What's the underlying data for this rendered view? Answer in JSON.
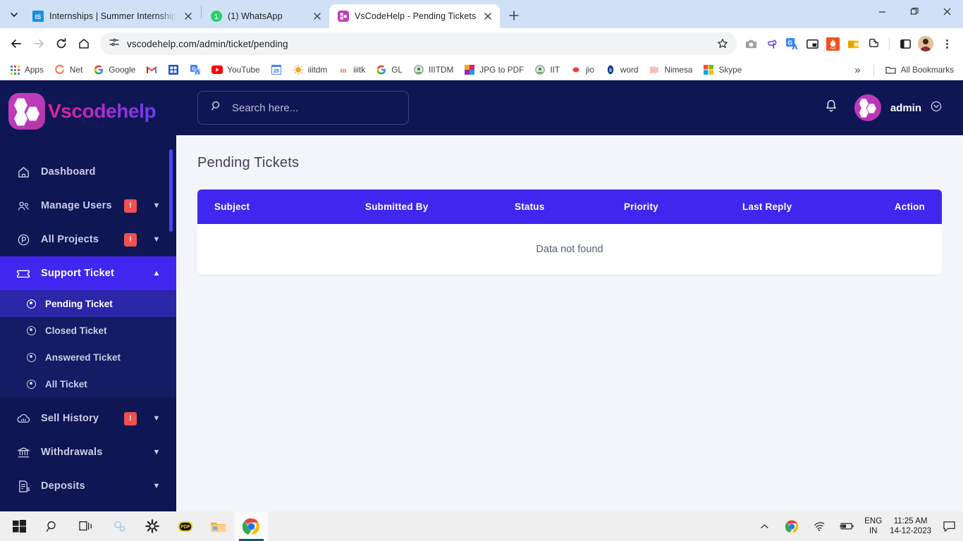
{
  "browser": {
    "tabs": [
      {
        "title": "Internships | Summer Internship",
        "favicon": "internshala-icon",
        "active": false
      },
      {
        "title": "(1) WhatsApp",
        "favicon": "whatsapp-icon",
        "active": false
      },
      {
        "title": "VsCodeHelp - Pending Tickets",
        "favicon": "vscodehelp-icon",
        "active": true
      }
    ],
    "new_tab_label": "+",
    "tab_list_icon": "chevron-down-icon",
    "window_controls": {
      "minimize": "—",
      "maximize": "❐",
      "close": "✕"
    },
    "nav": {
      "back_icon": "back-arrow-icon",
      "forward_icon": "forward-arrow-icon",
      "reload_icon": "reload-icon",
      "home_icon": "home-icon",
      "site_info_icon": "site-settings-icon",
      "url": "vscodehelp.com/admin/ticket/pending",
      "bookmark_icon": "star-icon"
    },
    "extensions": [
      "screenshot-icon",
      "clipboard-icon",
      "google-translate-icon",
      "picture-in-picture-icon",
      "fireshot-icon",
      "wallet-icon",
      "puzzle-extensions-icon",
      "side-panel-icon",
      "profile-avatar-icon",
      "chrome-menu-icon"
    ],
    "bookmarks": [
      {
        "label": "Apps",
        "icon": "apps-grid-icon"
      },
      {
        "label": "Net",
        "icon": "net-icon"
      },
      {
        "label": "Google",
        "icon": "google-icon"
      },
      {
        "label": "",
        "icon": "gmail-icon"
      },
      {
        "label": "",
        "icon": "calendar-blue-icon"
      },
      {
        "label": "",
        "icon": "google-translate-icon"
      },
      {
        "label": "YouTube",
        "icon": "youtube-icon"
      },
      {
        "label": "",
        "icon": "calendar-25-icon"
      },
      {
        "label": "iiitdm",
        "icon": "iiitdm-icon"
      },
      {
        "label": "iiitk",
        "icon": "iiitk-icon"
      },
      {
        "label": "GL",
        "icon": "google-g-icon"
      },
      {
        "label": "IIITDM",
        "icon": "iiitdm-seal-icon"
      },
      {
        "label": "JPG to PDF",
        "icon": "jpg-to-pdf-icon"
      },
      {
        "label": "IIT",
        "icon": "iit-seal-icon"
      },
      {
        "label": "jio",
        "icon": "jio-icon"
      },
      {
        "label": "word",
        "icon": "word-icon"
      },
      {
        "label": "Nimesa",
        "icon": "nimesa-icon"
      },
      {
        "label": "Skype",
        "icon": "skype-icon"
      }
    ],
    "bookmarks_overflow_icon": "chevron-double-right-icon",
    "all_bookmarks_label": "All Bookmarks",
    "all_bookmarks_icon": "folder-icon"
  },
  "app": {
    "brand": {
      "name": "Vscodehelp",
      "mark": "vscodehelp-hexagon-logo"
    },
    "search": {
      "placeholder": "Search here...",
      "value": "",
      "icon": "search-icon"
    },
    "header": {
      "notification_icon": "bell-icon",
      "user_name": "admin",
      "user_menu_icon": "chevron-circle-down-icon",
      "avatar": "admin-avatar"
    },
    "sidebar": {
      "items": [
        {
          "label": "Dashboard",
          "icon": "home-icon",
          "badge": null,
          "chevron": null,
          "active": false
        },
        {
          "label": "Manage Users",
          "icon": "users-icon",
          "badge": "!",
          "chevron": "chevron-down-icon",
          "active": false
        },
        {
          "label": "All Projects",
          "icon": "project-circle-icon",
          "badge": "!",
          "chevron": "chevron-down-icon",
          "active": false
        },
        {
          "label": "Support Ticket",
          "icon": "ticket-icon",
          "badge": null,
          "chevron": "chevron-up-icon",
          "active": true
        }
      ],
      "submenu": [
        {
          "label": "Pending Ticket",
          "icon": "radio-dot-icon",
          "current": true
        },
        {
          "label": "Closed Ticket",
          "icon": "radio-dot-icon",
          "current": false
        },
        {
          "label": "Answered Ticket",
          "icon": "radio-dot-icon",
          "current": false
        },
        {
          "label": "All Ticket",
          "icon": "radio-dot-icon",
          "current": false
        }
      ],
      "items_after": [
        {
          "label": "Sell History",
          "icon": "cloud-chart-icon",
          "badge": "!",
          "chevron": "chevron-down-icon",
          "active": false
        },
        {
          "label": "Withdrawals",
          "icon": "bank-icon",
          "badge": null,
          "chevron": "chevron-down-icon",
          "active": false
        },
        {
          "label": "Deposits",
          "icon": "invoice-dollar-icon",
          "badge": null,
          "chevron": "chevron-down-icon",
          "active": false
        }
      ]
    },
    "main": {
      "page_title": "Pending Tickets",
      "table": {
        "columns": [
          "Subject",
          "Submitted By",
          "Status",
          "Priority",
          "Last Reply",
          "Action"
        ],
        "rows": [],
        "empty_message": "Data not found"
      }
    },
    "colors": {
      "sidebar_bg": "#0f1654",
      "accent_primary": "#4027ef",
      "submenu_bg": "#141c63",
      "submenu_active": "#2b27a8",
      "badge_red": "#f05050",
      "brand_pink": "#e5238f",
      "brand_purple": "#6a3ef0",
      "content_bg": "#f4f5fa"
    }
  },
  "taskbar": {
    "buttons": [
      {
        "icon": "windows-start-icon",
        "name": "start-button",
        "running": false
      },
      {
        "icon": "search-icon",
        "name": "taskbar-search",
        "running": false
      },
      {
        "icon": "task-view-icon",
        "name": "task-view-button",
        "running": false
      },
      {
        "icon": "gears-blue-icon",
        "name": "taskbar-app-gears",
        "running": false
      },
      {
        "icon": "settings-gear-icon",
        "name": "taskbar-settings",
        "running": false
      },
      {
        "icon": "pdf-icon",
        "name": "taskbar-pdf-reader",
        "running": false
      },
      {
        "icon": "file-explorer-icon",
        "name": "taskbar-file-explorer",
        "running": false
      },
      {
        "icon": "chrome-icon",
        "name": "taskbar-chrome",
        "running": true
      }
    ],
    "tray": {
      "overflow_icon": "chevron-up-icon",
      "chrome_icon": "chrome-icon",
      "network_icon": "wifi-icon",
      "battery_icon": "battery-icon",
      "language_line1": "ENG",
      "language_line2": "IN",
      "time": "11:25 AM",
      "date": "14-12-2023",
      "action_center_icon": "speech-bubble-icon"
    }
  }
}
